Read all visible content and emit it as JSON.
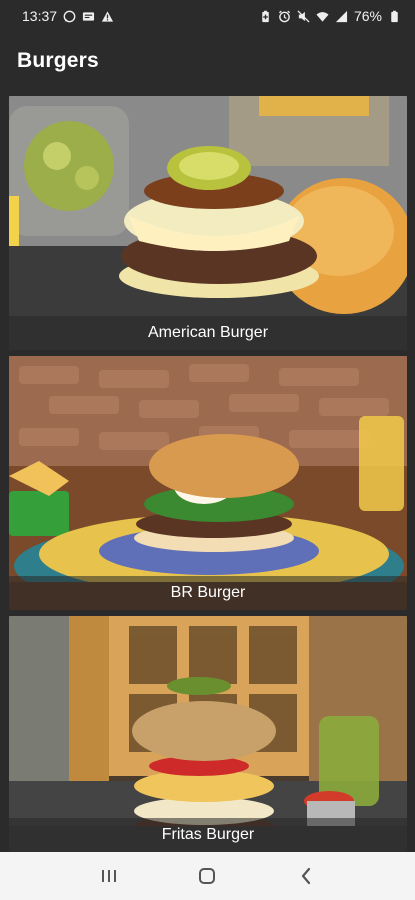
{
  "status": {
    "time": "13:37",
    "battery": "76%",
    "left_icons": [
      "whatsapp-icon",
      "message-icon",
      "warning-icon"
    ],
    "right_icons": [
      "battery-saver-icon",
      "alarm-icon",
      "mute-icon",
      "wifi-icon",
      "signal-icon",
      "battery-icon"
    ]
  },
  "app_bar": {
    "title": "Burgers"
  },
  "burgers": [
    {
      "name": "American Burger"
    },
    {
      "name": "BR Burger"
    },
    {
      "name": "Fritas Burger"
    }
  ],
  "nav": {
    "items": [
      "recents-icon",
      "home-icon",
      "back-icon"
    ]
  },
  "colors": {
    "background": "#2b2b2b",
    "nav_bar": "#f4f4f4",
    "caption_overlay": "rgba(40,40,40,0.55)"
  }
}
